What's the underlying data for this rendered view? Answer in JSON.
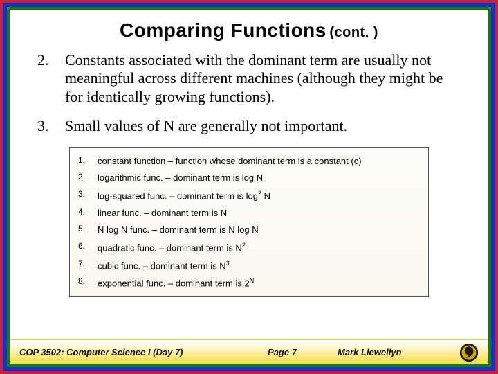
{
  "title": "Comparing Functions",
  "title_cont": "(cont. )",
  "body": [
    {
      "num": "2.",
      "text": "Constants associated with the dominant term are usually not meaningful across different machines (although they might be for identically growing functions)."
    },
    {
      "num": "3.",
      "text": "Small values of N are generally not important."
    }
  ],
  "box": [
    {
      "num": "1.",
      "html": "constant function – function whose dominant term is a constant (c)"
    },
    {
      "num": "2.",
      "html": "logarithmic func. – dominant term is log N"
    },
    {
      "num": "3.",
      "html": "log-squared func. – dominant term is log<span class='sup'>2</span> N"
    },
    {
      "num": "4.",
      "html": "linear func. – dominant term is N"
    },
    {
      "num": "5.",
      "html": "N log N func. – dominant term is N log N"
    },
    {
      "num": "6.",
      "html": "quadratic func. – dominant term is N<span class='sup'>2</span>"
    },
    {
      "num": "7.",
      "html": "cubic func. – dominant term is N<span class='sup'>3</span>"
    },
    {
      "num": "8.",
      "html": "exponential func. – dominant term is 2<span class='sup'>N</span>"
    }
  ],
  "footer": {
    "course": "COP 3502: Computer Science I  (Day 7)",
    "page": "Page 7",
    "author": "Mark Llewellyn"
  }
}
